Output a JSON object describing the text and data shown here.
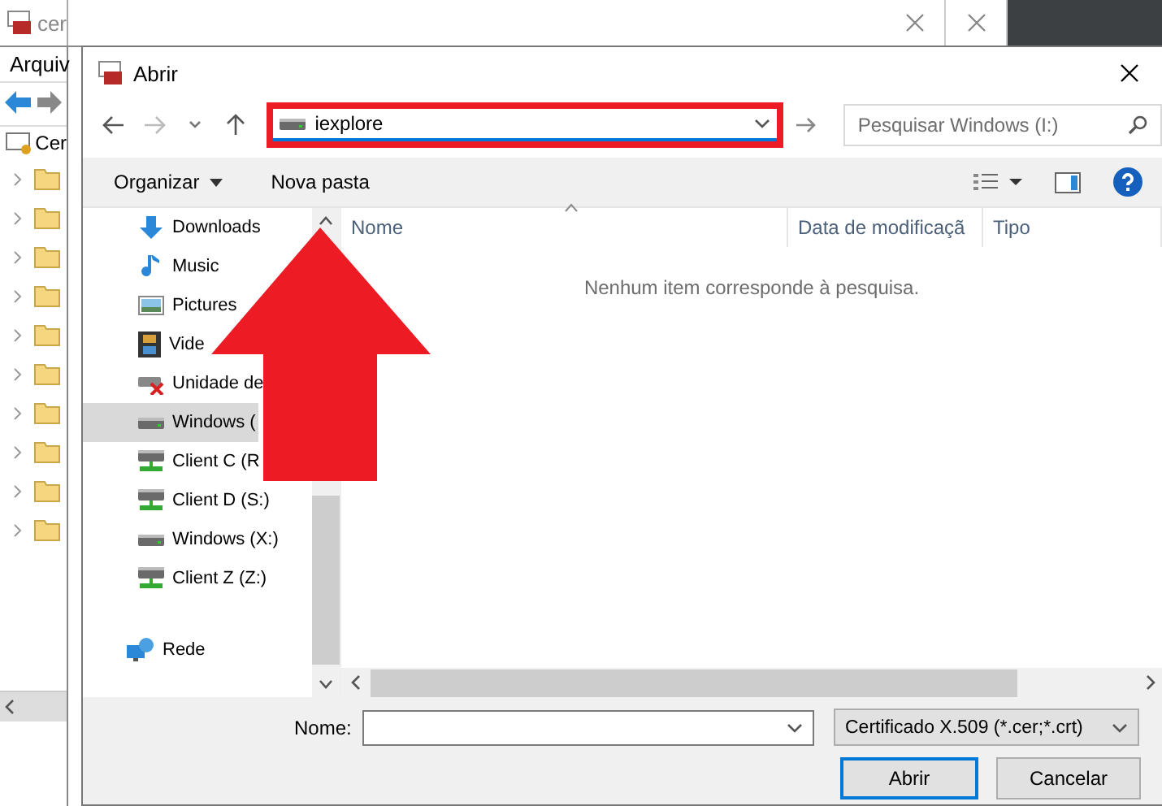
{
  "background_window": {
    "title": "cer",
    "menu": [
      "Arquiv"
    ],
    "tree": {
      "label": "Cer",
      "children": [
        {
          "expanded": false
        },
        {
          "expanded": false
        },
        {
          "expanded": false
        },
        {
          "expanded": false
        },
        {
          "expanded": false
        },
        {
          "expanded": false
        },
        {
          "expanded": false
        },
        {
          "expanded": false
        },
        {
          "expanded": false
        },
        {
          "expanded": false
        }
      ]
    }
  },
  "dialog": {
    "title": "Abrir",
    "address": {
      "value": "iexplore"
    },
    "search": {
      "placeholder": "Pesquisar Windows (I:)"
    },
    "toolbar": [
      {
        "label": "Organizar",
        "kind": "menu"
      },
      {
        "label": "Nova pasta",
        "kind": "button"
      }
    ],
    "nav_items": [
      {
        "label": "Downloads",
        "kind": "download",
        "selected": false
      },
      {
        "label": "Music",
        "kind": "music",
        "selected": false
      },
      {
        "label": "Pictures",
        "kind": "pictures",
        "selected": false
      },
      {
        "label": "Vide",
        "kind": "video",
        "selected": false
      },
      {
        "label": "Unidade de",
        "kind": "drive-offline",
        "selected": false
      },
      {
        "label": "Windows (",
        "kind": "drive",
        "selected": true
      },
      {
        "label": "Client C (R",
        "kind": "network-drive",
        "selected": false
      },
      {
        "label": "Client D (S:)",
        "kind": "network-drive",
        "selected": false
      },
      {
        "label": "Windows (X:)",
        "kind": "drive",
        "selected": false
      },
      {
        "label": "Client Z (Z:)",
        "kind": "network-drive",
        "selected": false
      },
      {
        "label": "Rede",
        "kind": "network",
        "selected": false
      }
    ],
    "columns": [
      {
        "label": "Nome",
        "sorted": true
      },
      {
        "label": "Data de modificaçã",
        "sorted": false
      },
      {
        "label": "Tipo",
        "sorted": false
      }
    ],
    "empty_message": "Nenhum item corresponde à pesquisa.",
    "footer": {
      "name_label": "Nome:",
      "file_type": "Certificado X.509 (*.cer;*.crt)",
      "buttons": [
        {
          "label": "Abrir",
          "default": true
        },
        {
          "label": "Cancelar",
          "default": false
        }
      ]
    }
  }
}
